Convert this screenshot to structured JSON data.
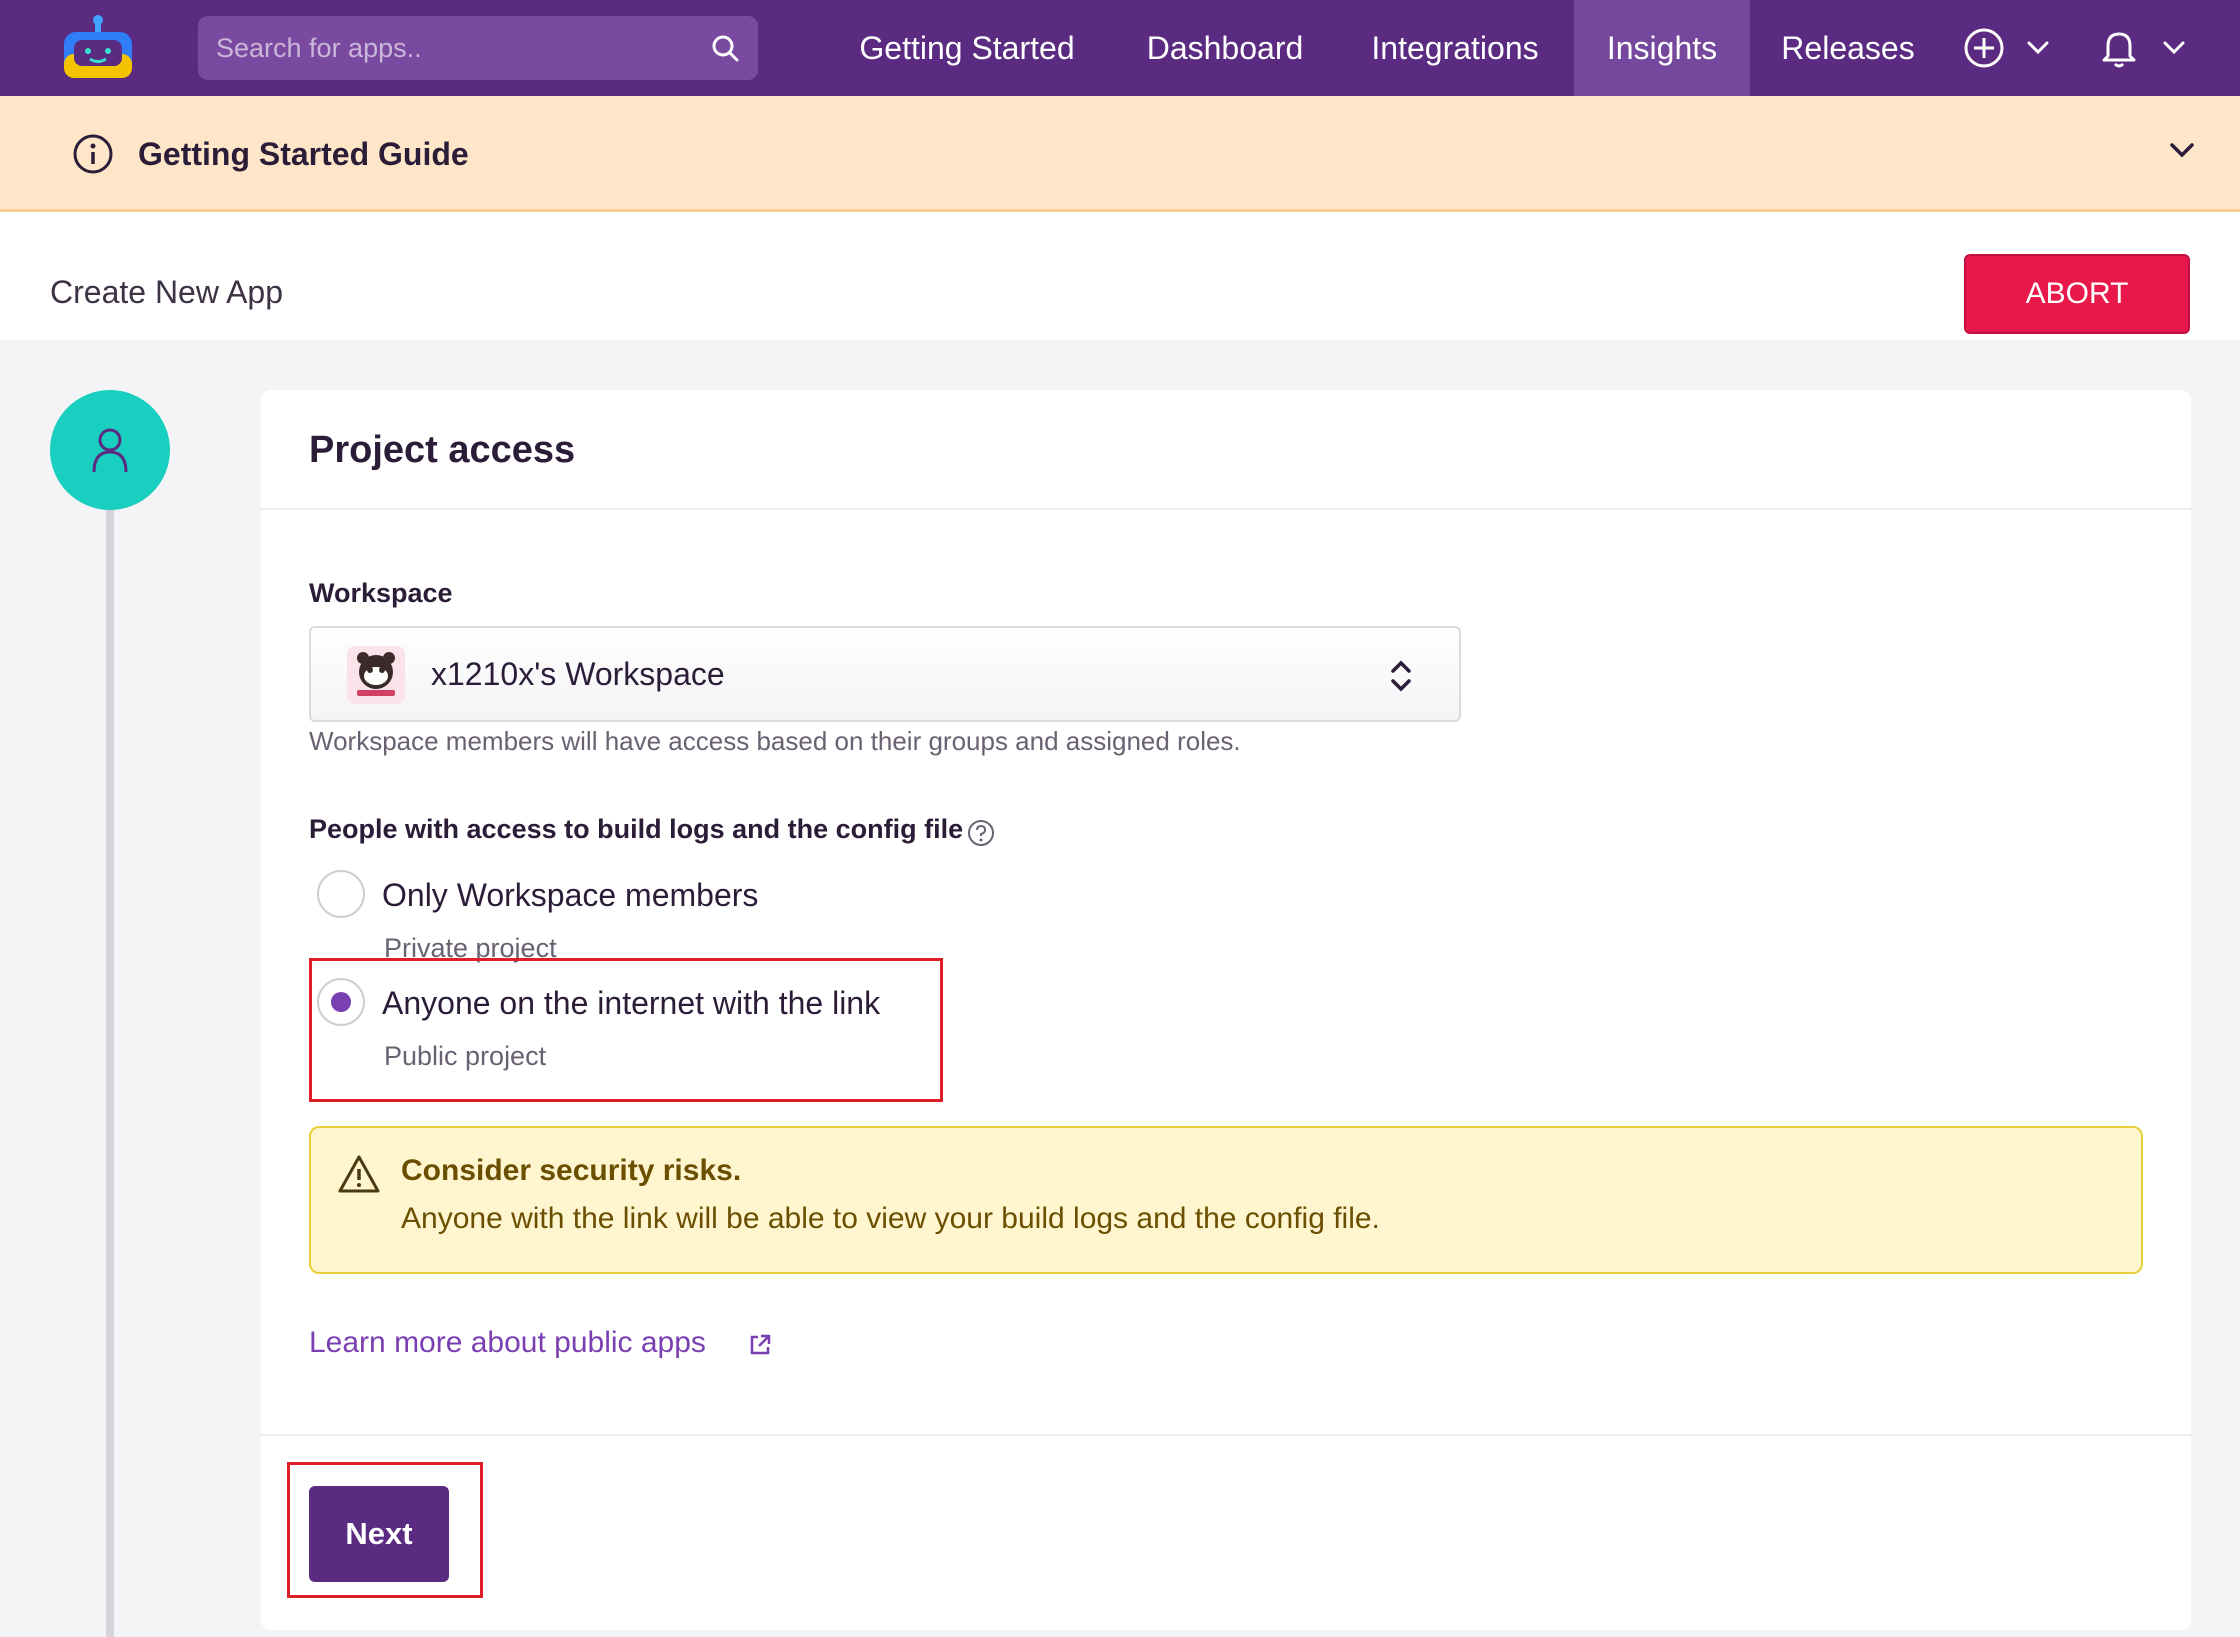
{
  "nav": {
    "search_placeholder": "Search for apps..",
    "items": [
      "Getting Started",
      "Dashboard",
      "Integrations",
      "Insights",
      "Releases"
    ],
    "active": "Insights"
  },
  "guide": {
    "title": "Getting Started Guide"
  },
  "page": {
    "title": "Create New App",
    "abort_label": "ABORT"
  },
  "card": {
    "title": "Project access",
    "workspace": {
      "label": "Workspace",
      "value": "x1210x's Workspace",
      "helper": "Workspace members will have access based on their groups and assigned roles."
    },
    "access": {
      "label": "People with access to build logs and the config file",
      "options": [
        {
          "label": "Only Workspace members",
          "sub": "Private project",
          "selected": false
        },
        {
          "label": "Anyone on the internet with the link",
          "sub": "Public project",
          "selected": true
        }
      ]
    },
    "warning": {
      "title": "Consider security risks.",
      "text": "Anyone with the link will be able to view your build logs and the config file."
    },
    "learn_more": "Learn more about public apps",
    "next_label": "Next"
  },
  "colors": {
    "brand": "#5b2b82",
    "abort": "#e8194a",
    "step": "#18cfc0",
    "highlight": "#e01e2a"
  }
}
